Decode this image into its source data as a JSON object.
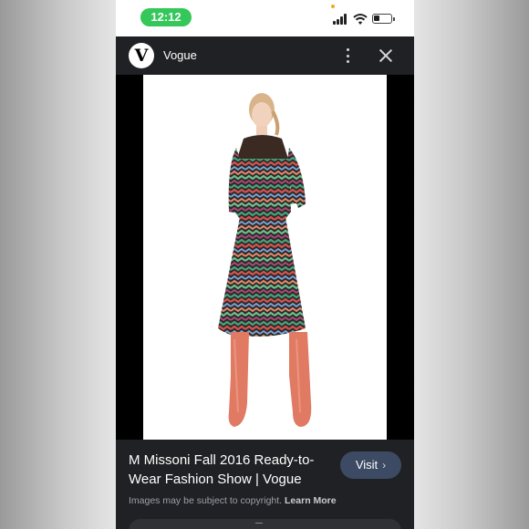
{
  "status_bar": {
    "time": "12:12",
    "icons": [
      "signal-icon",
      "wifi-icon",
      "battery-icon"
    ],
    "time_pill_color": "#34c759"
  },
  "viewer": {
    "source": {
      "logo_letter": "V",
      "name": "Vogue"
    },
    "header_icons": [
      "more-vert-icon",
      "close-icon"
    ],
    "image": {
      "subject": "model in zigzag knit dress with coral boots"
    },
    "title": "M Missoni Fall 2016 Ready-to-Wear Fashion Show | Vogue",
    "visit_label": "Visit",
    "copyright_text": "Images may be subject to copyright.",
    "learn_more_label": "Learn More",
    "accent_color": "#3c4b63",
    "background_color": "#202124"
  }
}
